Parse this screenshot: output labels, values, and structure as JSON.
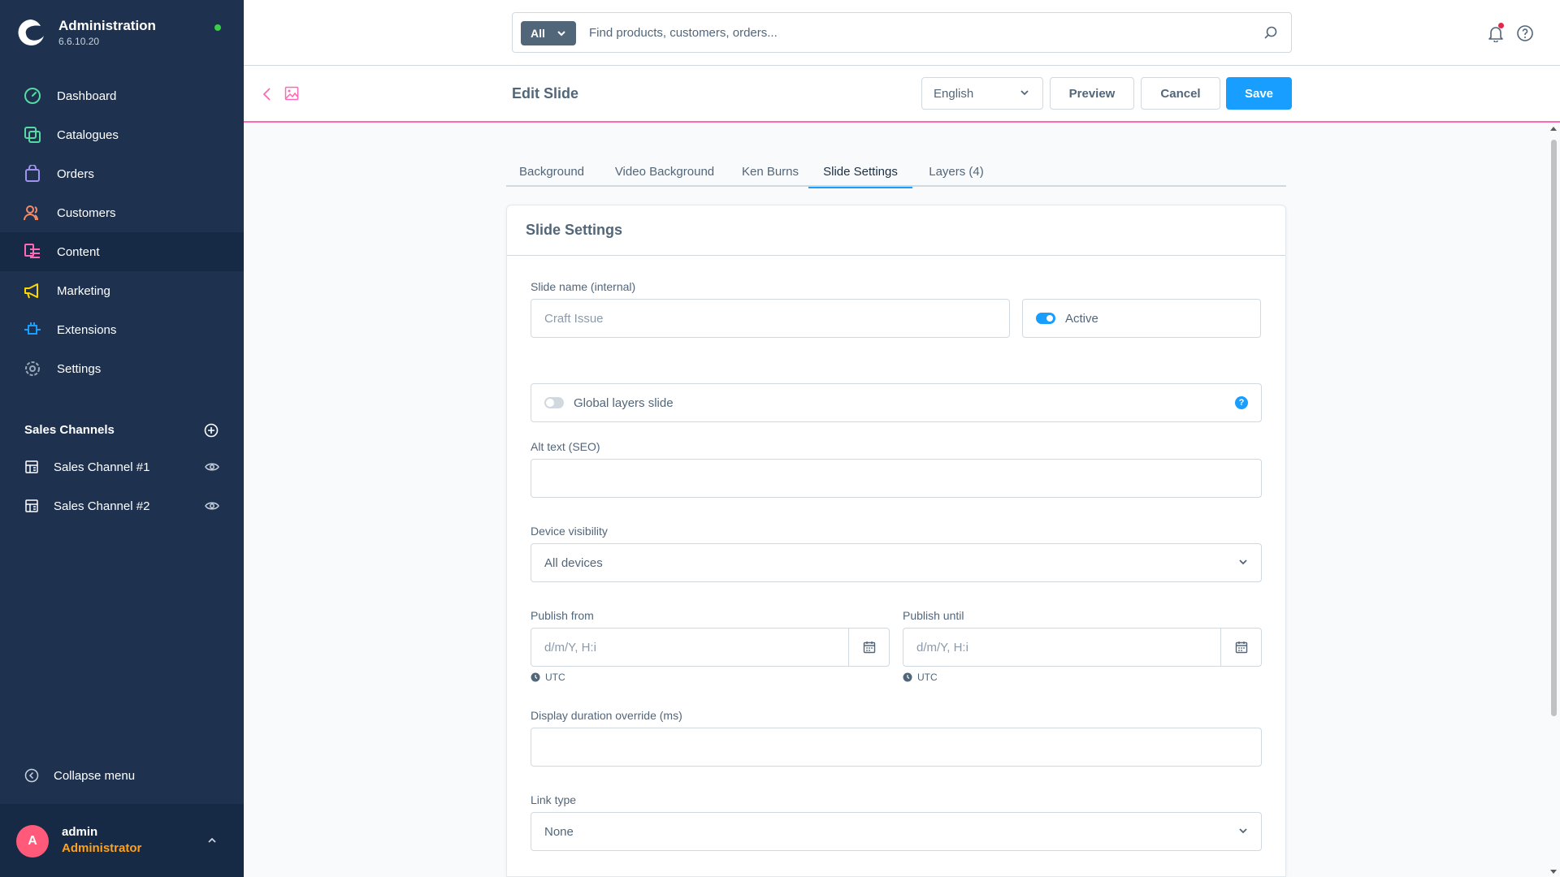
{
  "app": {
    "title": "Administration",
    "version": "6.6.10.20"
  },
  "sidebar": {
    "items": [
      {
        "label": "Dashboard",
        "icon": "dashboard-icon",
        "color": "#57d9a3"
      },
      {
        "label": "Catalogues",
        "icon": "catalogue-icon",
        "color": "#57d9a3"
      },
      {
        "label": "Orders",
        "icon": "orders-icon",
        "color": "#a092f0"
      },
      {
        "label": "Customers",
        "icon": "customers-icon",
        "color": "#f88962"
      },
      {
        "label": "Content",
        "icon": "content-icon",
        "color": "#ff68b4",
        "active": true
      },
      {
        "label": "Marketing",
        "icon": "marketing-icon",
        "color": "#ffd700"
      },
      {
        "label": "Extensions",
        "icon": "extensions-icon",
        "color": "#189eff"
      },
      {
        "label": "Settings",
        "icon": "settings-icon",
        "color": "#9aa8b5"
      }
    ],
    "sales_channels_title": "Sales Channels",
    "sales_channels": [
      {
        "label": "Sales Channel #1"
      },
      {
        "label": "Sales Channel #2"
      }
    ],
    "collapse_label": "Collapse menu"
  },
  "user": {
    "initial": "A",
    "name": "admin",
    "role": "Administrator"
  },
  "search": {
    "type_label": "All",
    "placeholder": "Find products, customers, orders..."
  },
  "page": {
    "title": "Edit Slide",
    "language": "English",
    "preview_label": "Preview",
    "cancel_label": "Cancel",
    "save_label": "Save"
  },
  "tabs": [
    {
      "label": "Background"
    },
    {
      "label": "Video Background"
    },
    {
      "label": "Ken Burns"
    },
    {
      "label": "Slide Settings",
      "active": true
    },
    {
      "label": "Layers (4)"
    }
  ],
  "form": {
    "card_title": "Slide Settings",
    "slide_name_label": "Slide name (internal)",
    "slide_name_placeholder": "Craft Issue",
    "active_label": "Active",
    "active_on": true,
    "global_layers_label": "Global layers slide",
    "global_layers_on": false,
    "alt_text_label": "Alt text (SEO)",
    "device_visibility_label": "Device visibility",
    "device_visibility_value": "All devices",
    "publish_from_label": "Publish from",
    "publish_from_placeholder": "d/m/Y, H:i",
    "publish_until_label": "Publish until",
    "publish_until_placeholder": "d/m/Y, H:i",
    "timezone": "UTC",
    "display_duration_label": "Display duration override (ms)",
    "link_type_label": "Link type",
    "link_type_value": "None"
  },
  "colors": {
    "sidebar_bg": "#1e3250",
    "accent": "#189eff",
    "content_accent": "#ff68b4",
    "role_color": "#ffa11c"
  }
}
